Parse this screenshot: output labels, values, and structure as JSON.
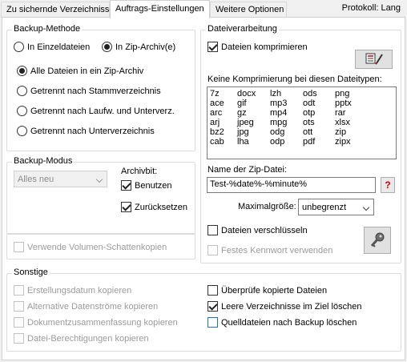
{
  "tabs": [
    {
      "label": "Zu sichernde Verzeichnisse"
    },
    {
      "label": "Auftrags-Einstellungen"
    },
    {
      "label": "Weitere Optionen"
    }
  ],
  "protocol": "Protokoll: Lang",
  "backup_method": {
    "legend": "Backup-Methode",
    "opt_single": "In Einzeldateien",
    "opt_zip": "In Zip-Archiv(e)",
    "options": [
      "Alle Dateien in ein Zip-Archiv",
      "Getrennt nach Stammverzeichnis",
      "Getrennt nach Laufw. und Unterverz.",
      "Getrennt nach Unterverzeichnis"
    ]
  },
  "backup_mode": {
    "legend": "Backup-Modus",
    "select_value": "Alles neu",
    "archive_bit_label": "Archivbit:",
    "use_label": "Benutzen",
    "reset_label": "Zurücksetzen"
  },
  "shadow_copy_label": "Verwende Volumen-Schattenkopien",
  "file_processing": {
    "legend": "Dateiverarbeitung",
    "compress_label": "Dateien komprimieren",
    "no_compress_label": "Keine Komprimierung bei diesen Dateitypen:",
    "types": [
      "7z",
      "docx",
      "lzh",
      "ods",
      "png",
      "ace",
      "gif",
      "mp3",
      "odt",
      "pptx",
      "arc",
      "gz",
      "mp4",
      "otp",
      "rar",
      "arj",
      "jpeg",
      "mpg",
      "ots",
      "xlsx",
      "bz2",
      "jpg",
      "odg",
      "ott",
      "zip",
      "cab",
      "lha",
      "odp",
      "pdf",
      "zipx"
    ],
    "zip_name_label": "Name der Zip-Datei:",
    "zip_name_value": "Test-%date%-%minute%",
    "help_button": "?",
    "max_size_label": "Maximalgröße:",
    "max_size_value": "unbegrenzt",
    "encrypt_label": "Dateien verschlüsseln",
    "fixed_password_label": "Festes Kennwort verwenden"
  },
  "misc": {
    "legend": "Sonstige",
    "left": [
      "Erstellungsdatum kopieren",
      "Alternative Datenströme kopieren",
      "Dokumentzusammenfassung kopieren",
      "Datei-Berechtigungen kopieren"
    ],
    "verify_label": "Überprüfe kopierte Dateien",
    "delete_empty_label": "Leere Verzeichnisse im Ziel löschen",
    "delete_source_label": "Quelldateien nach Backup löschen"
  }
}
